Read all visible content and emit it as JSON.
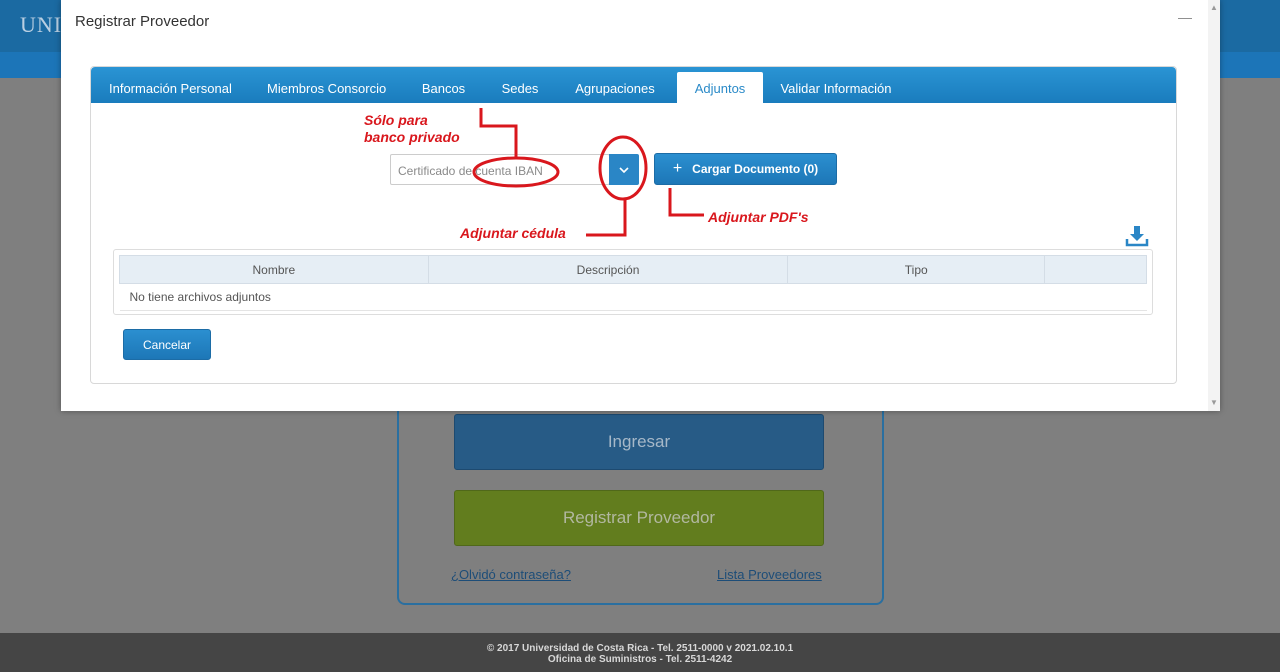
{
  "background": {
    "logo_text": "UNIV",
    "login_button": "Ingresar",
    "register_button": "Registrar Proveedor",
    "forgot_link": "¿Olvidó contraseña?",
    "providers_link": "Lista Proveedores",
    "footer_line1": "© 2017 Universidad de Costa Rica - Tel. 2511-0000 v 2021.02.10.1",
    "footer_line2": "Oficina de Suministros - Tel. 2511-4242"
  },
  "modal": {
    "title": "Registrar Proveedor",
    "tabs": [
      {
        "label": "Información Personal",
        "active": false
      },
      {
        "label": "Miembros Consorcio",
        "active": false
      },
      {
        "label": "Bancos",
        "active": false
      },
      {
        "label": "Sedes",
        "active": false
      },
      {
        "label": "Agrupaciones",
        "active": false
      },
      {
        "label": "Adjuntos",
        "active": true
      },
      {
        "label": "Validar Información",
        "active": false
      }
    ],
    "document_select": {
      "value": "Certificado de cuenta IBAN"
    },
    "upload_button": "Cargar Documento (0)",
    "table": {
      "columns": [
        "Nombre",
        "Descripción",
        "Tipo",
        ""
      ],
      "empty_message": "No tiene archivos adjuntos"
    },
    "cancel_button": "Cancelar"
  },
  "annotations": {
    "private_bank_line1": "Sólo para",
    "private_bank_line2": "banco privado",
    "attach_id": "Adjuntar cédula",
    "attach_pdf": "Adjuntar PDF's"
  },
  "colors": {
    "accent": "#1f82c4",
    "annotation_red": "#d9171d",
    "register_green": "#627d1e"
  }
}
